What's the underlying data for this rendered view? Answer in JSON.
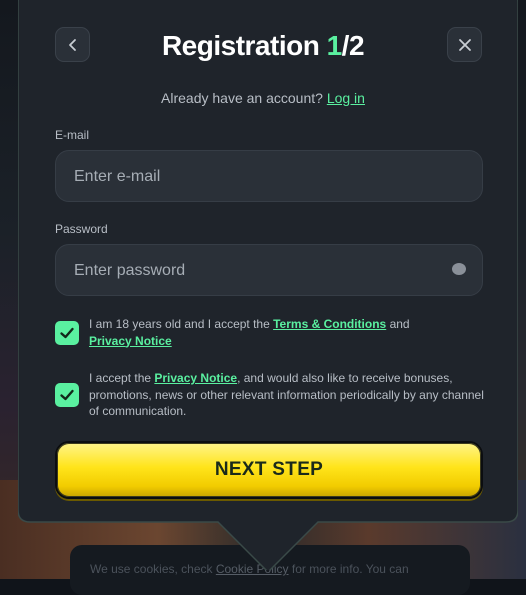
{
  "header": {
    "title_prefix": "Registration ",
    "step_current": "1",
    "step_total": "/2"
  },
  "account_prompt": {
    "text": "Already have an account? ",
    "login_link": "Log in"
  },
  "email": {
    "label": "E-mail",
    "placeholder": "Enter e-mail",
    "value": ""
  },
  "password": {
    "label": "Password",
    "placeholder": "Enter password",
    "value": ""
  },
  "consents": [
    {
      "checked": true,
      "text_before": "I am 18 years old and I accept the ",
      "link1": "Terms & Conditions",
      "text_middle": " and ",
      "link2": "Privacy Notice"
    },
    {
      "checked": true,
      "text_before": "I accept the ",
      "link1": "Privacy Notice",
      "text_after": ", and would also like to receive bonuses, promotions, news or other relevant information periodically by any channel of communication."
    }
  ],
  "submit": {
    "label": "NEXT STEP"
  },
  "cookie_banner": {
    "text_before": "We use cookies, check ",
    "link": "Cookie Policy",
    "text_after": " for more info. You can"
  },
  "colors": {
    "accent": "#5af0a0",
    "button_yellow": "#ffe41a",
    "card_bg": "#1f242b"
  }
}
